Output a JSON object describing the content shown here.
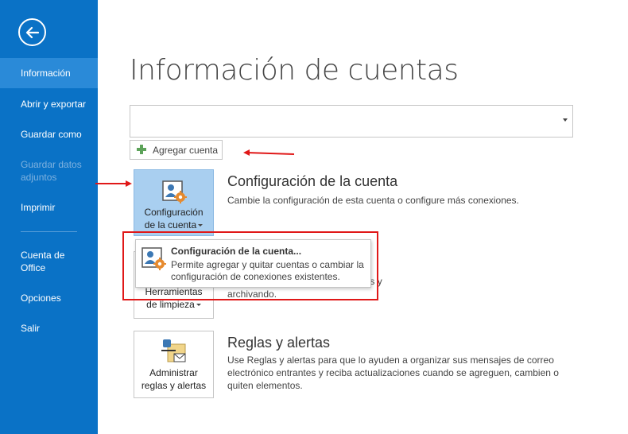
{
  "sidebar": {
    "back_icon": "back-arrow-icon",
    "items": [
      {
        "label": "Información"
      },
      {
        "label": "Abrir y exportar"
      },
      {
        "label": "Guardar como"
      },
      {
        "label": "Guardar datos adjuntos"
      },
      {
        "label": "Imprimir"
      },
      {
        "label": "Cuenta de Office"
      },
      {
        "label": "Opciones"
      },
      {
        "label": "Salir"
      }
    ]
  },
  "main": {
    "title": "Información de cuentas",
    "account_select": {
      "value": ""
    },
    "add_account": {
      "label": "Agregar cuenta",
      "icon": "plus-icon"
    },
    "sections": [
      {
        "tile_line1": "Configuración",
        "tile_line2": "de la cuenta",
        "title": "Configuración de la cuenta",
        "desc": "Cambie la configuración de esta cuenta o configure más conexiones."
      },
      {
        "tile_line1": "Herramientas",
        "tile_line2": "de limpieza",
        "desc_line1": "…ciando los elementos eliminados y",
        "desc_line2": "archivando."
      },
      {
        "tile_line1": "Administrar",
        "tile_line2": "reglas y alertas",
        "title": "Reglas y alertas",
        "desc": "Use Reglas y alertas para que lo ayuden a organizar sus mensajes de correo electrónico entrantes y reciba actualizaciones cuando se agreguen, cambien o quiten elementos."
      }
    ],
    "dropdown": {
      "title": "Configuración de la cuenta...",
      "desc": "Permite agregar y quitar cuentas o cambiar la configuración de conexiones existentes."
    }
  },
  "colors": {
    "sidebar": "#0a72c6",
    "active": "#2a8ad8",
    "annotation": "#e01818",
    "selected_tile": "#a9cff0"
  }
}
